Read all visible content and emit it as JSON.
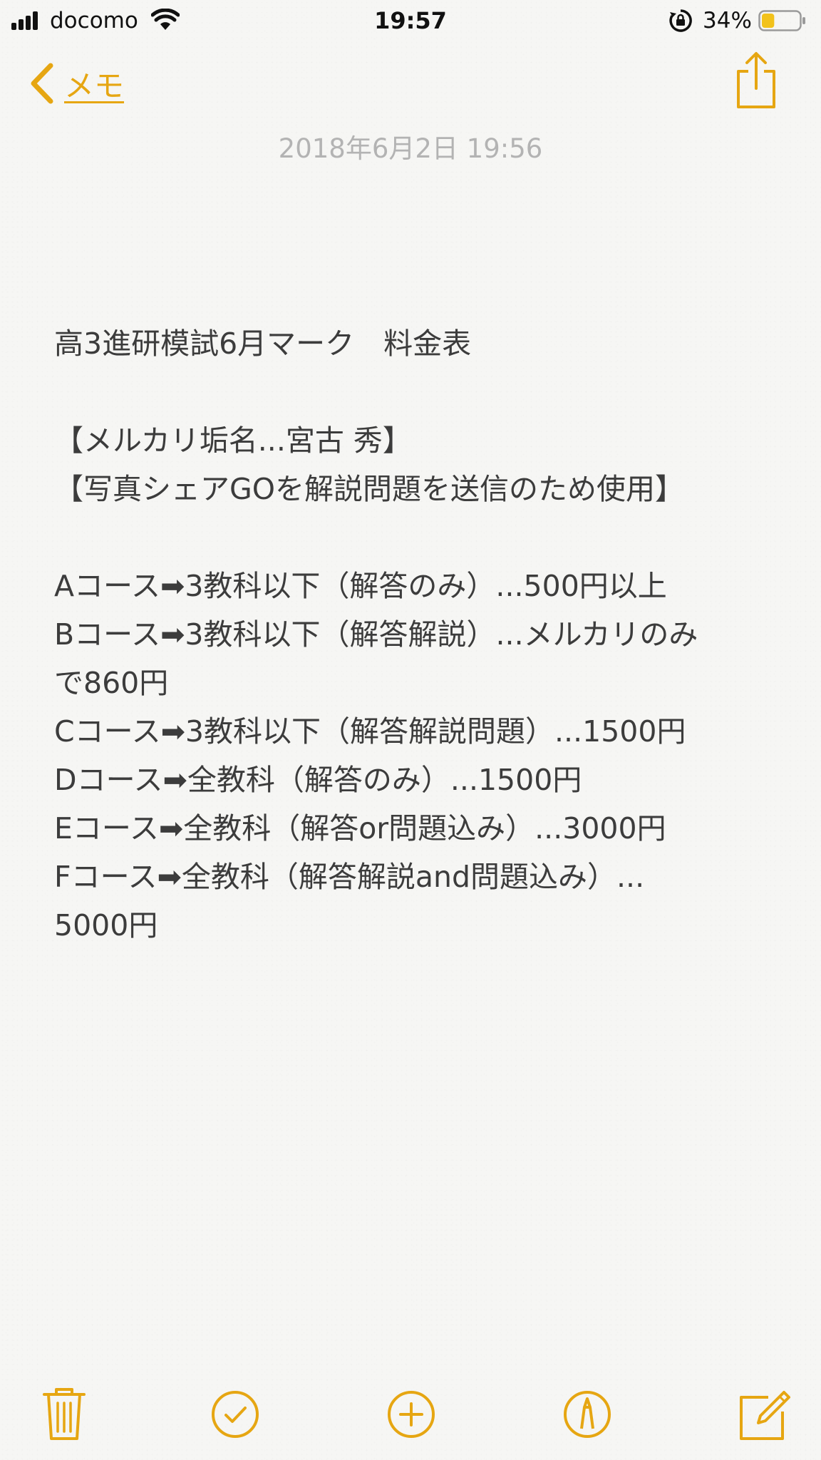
{
  "status_bar": {
    "carrier": "docomo",
    "time": "19:57",
    "battery_percent": "34%",
    "battery_level": 0.34,
    "icons": [
      "signal-icon",
      "wifi-icon",
      "rotation-lock-icon",
      "battery-icon"
    ]
  },
  "nav": {
    "back_label": "メモ",
    "icons": [
      "chevron-left-icon",
      "share-icon"
    ]
  },
  "note": {
    "date": "2018年6月2日 19:56",
    "lines": [
      "高3進研模試6月マーク　料金表",
      "",
      "【メルカリ垢名...宮古 秀】",
      "【写真シェアGOを解説問題を送信のため使用】",
      "",
      "Aコース➡3教科以下（解答のみ）...500円以上",
      "Bコース➡3教科以下（解答解説）...メルカリのみ",
      "で860円",
      "Cコース➡3教科以下（解答解説問題）...1500円",
      "Dコース➡全教科（解答のみ）...1500円",
      "Eコース➡全教科（解答or問題込み）...3000円",
      "Fコース➡全教科（解答解説and問題込み）...",
      "5000円"
    ]
  },
  "toolbar": {
    "icons": [
      "trash-icon",
      "checklist-icon",
      "add-icon",
      "markup-icon",
      "compose-icon"
    ]
  },
  "colors": {
    "accent": "#e6a612",
    "date_text": "#b3b3b3",
    "body_text": "#3c3c3c",
    "background": "#f6f6f4"
  }
}
